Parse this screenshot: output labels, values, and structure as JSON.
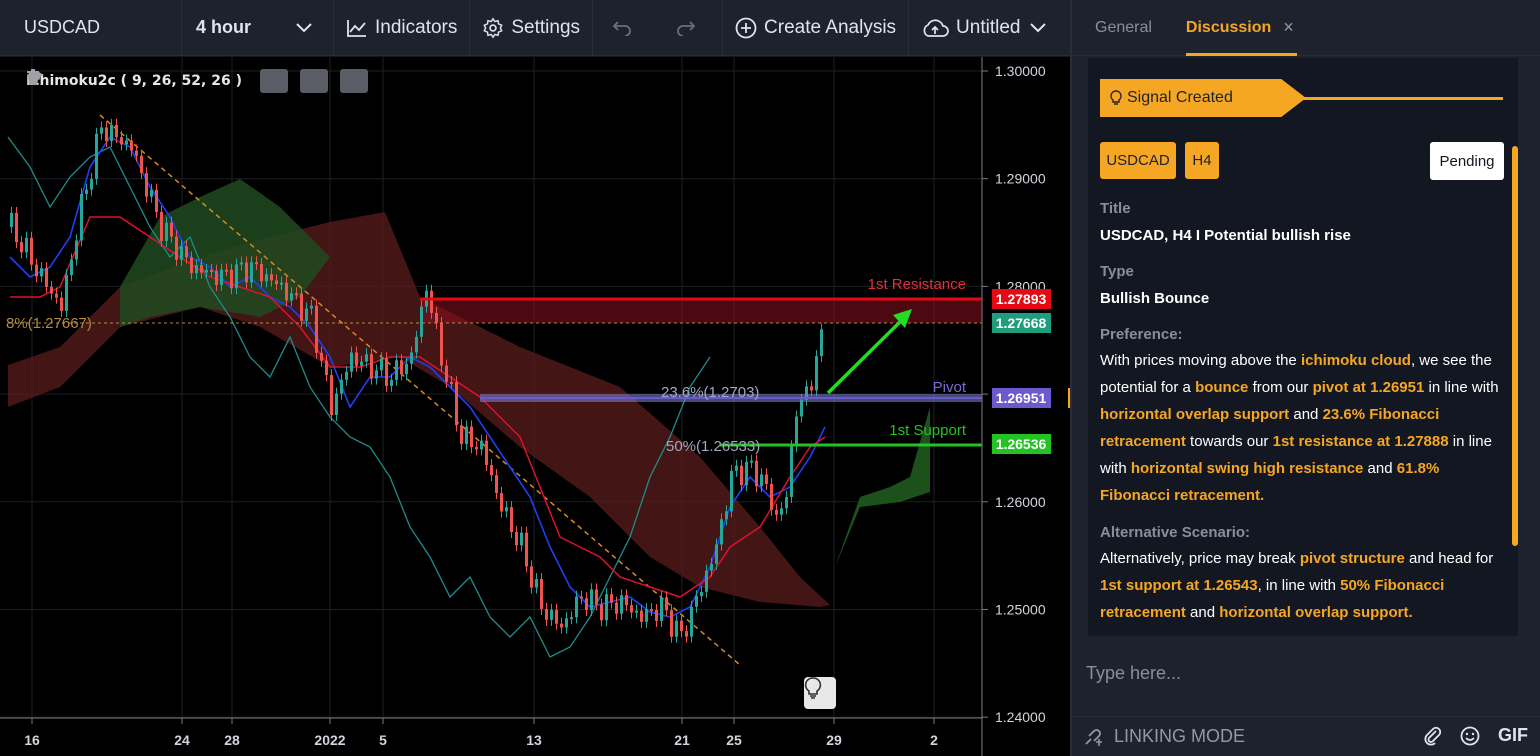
{
  "toolbar": {
    "symbol": "USDCAD",
    "interval": "4 hour",
    "indicators_label": "Indicators",
    "settings_label": "Settings",
    "create_analysis_label": "Create Analysis",
    "layout_name": "Untitled"
  },
  "chart": {
    "indicator_legend": "Ichimoku2c ( 9, 26, 52, 26 )",
    "price_ticks": [
      "1.30000",
      "1.29000",
      "1.28000",
      "1.27000",
      "1.26000",
      "1.25000",
      "1.24000"
    ],
    "time_ticks": [
      "16",
      "24",
      "28",
      "2022",
      "5",
      "13",
      "21",
      "25",
      "29",
      "2"
    ],
    "level_labels": {
      "resistance": "1st Resistance",
      "pivot": "Pivot",
      "support": "1st Support",
      "fib_236": "23.6%(1.2703)",
      "fib_50": "50%(1.26533)",
      "fib_618": "8%(1.27667)"
    },
    "price_badges": {
      "resistance": "1.27893",
      "fib": "1.27668",
      "pivot": "1.26951",
      "support": "1.26536"
    },
    "colors": {
      "resistance": "#e50914",
      "fib_badge": "#1e9e7c",
      "pivot": "#6a5acd",
      "support": "#22c322",
      "arrow": "#22dd22"
    }
  },
  "panel": {
    "tabs": [
      "General",
      "Discussion"
    ],
    "active_tab": "Discussion",
    "signal_label": "Signal Created",
    "symbol_badge": "USDCAD",
    "timeframe_badge": "H4",
    "status": "Pending",
    "title_label": "Title",
    "title_value": "USDCAD, H4 I Potential bullish rise",
    "type_label": "Type",
    "type_value": "Bullish Bounce",
    "preference_label": "Preference:",
    "preference_segments": [
      {
        "t": "With prices  moving above the "
      },
      {
        "t": "ichimoku cloud",
        "h": true
      },
      {
        "t": ", we see the potential for a "
      },
      {
        "t": "bounce",
        "h": true
      },
      {
        "t": " from our "
      },
      {
        "t": "pivot at 1.26951",
        "h": true
      },
      {
        "t": " in line with "
      },
      {
        "t": "horizontal overlap support",
        "h": true
      },
      {
        "t": " and "
      },
      {
        "t": "23.6% Fibonacci retracement",
        "h": true
      },
      {
        "t": "  towards our "
      },
      {
        "t": "1st resistance at 1.27888",
        "h": true
      },
      {
        "t": " in line with "
      },
      {
        "t": "horizontal swing high resistance",
        "h": true
      },
      {
        "t": " and "
      },
      {
        "t": "61.8% Fibonacci retracement.",
        "h": true
      }
    ],
    "alternative_label": "Alternative Scenario:",
    "alternative_segments": [
      {
        "t": "Alternatively, price may break "
      },
      {
        "t": "pivot structure",
        "h": true
      },
      {
        "t": " and head for "
      },
      {
        "t": "1st support at 1.26543",
        "h": true
      },
      {
        "t": ", in line with "
      },
      {
        "t": "50% Fibonacci retracement",
        "h": true
      },
      {
        "t": " and "
      },
      {
        "t": "horizontal overlap support.",
        "h": true
      }
    ],
    "message_placeholder": "Type here...",
    "linking_mode_label": "LINKING MODE",
    "gif_label": "GIF"
  }
}
